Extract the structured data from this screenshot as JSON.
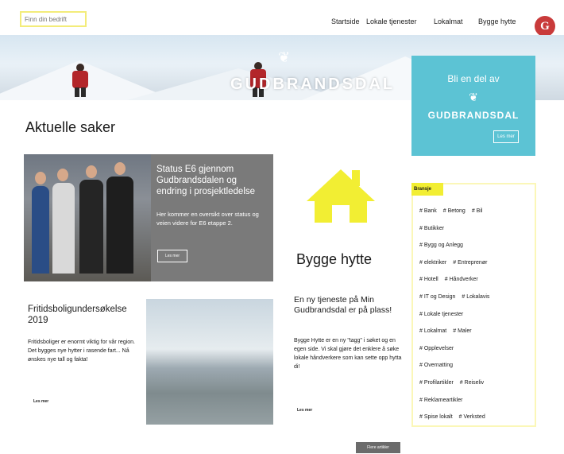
{
  "header": {
    "search_placeholder": "Finn din bedrift",
    "nav": [
      "Startside",
      "Lokale tjenester",
      "Lokalmat",
      "Bygge hytte"
    ],
    "logo_letter": "G"
  },
  "hero": {
    "title": "GUDBRANDSDAL"
  },
  "join_box": {
    "line1": "Bli en del av",
    "line2": "GUDBRANDSDAL",
    "button": "Les mer"
  },
  "section_title": "Aktuelle saker",
  "featured": {
    "title": "Status E6 gjennom Gudbrandsdalen og endring i prosjektledelse",
    "text": "Her kommer en oversikt over status og veien videre for E6 etappe 2.",
    "button": "Les mer"
  },
  "fritidsbolig": {
    "title": "Fritidsboligundersøkelse 2019",
    "text": "Fritidsboliger er enormt viktig for vår region. Det bygges nye hytter i rasende fart... Nå ønskes nye tall og fakta!",
    "more": "Les mer"
  },
  "bygge": {
    "title": "Bygge hytte",
    "article_title": "En ny tjeneste på Min Gudbrandsdal er på plass!",
    "article_text": "Bygge Hytte er en ny \"tagg\" i søket og en egen side. Vi skal gjøre det enklere å søke lokale håndverkere som kan sette opp hytta di!",
    "more": "Les mer"
  },
  "branch": {
    "heading": "Bransje",
    "rows": [
      [
        "# Bank",
        "# Betong",
        "# Bil"
      ],
      [
        "# Butikker"
      ],
      [
        "# Bygg og Anlegg"
      ],
      [
        "# elektriker",
        "# Entreprenør"
      ],
      [
        "# Hotell",
        "# Håndverker"
      ],
      [
        "# IT og Design",
        "# Lokalavis"
      ],
      [
        "# Lokale tjenester"
      ],
      [
        "# Lokalmat",
        "# Maler"
      ],
      [
        "# Opplevelser"
      ],
      [
        "# Overnatting"
      ],
      [
        "# Profilartikler",
        "# Reiseliv"
      ],
      [
        "# Reklameartikler"
      ],
      [
        "# Spise lokalt",
        "# Verksted"
      ]
    ]
  },
  "all_button": "Flere artikler",
  "colors": {
    "accent_yellow": "#f2ee33",
    "join_blue": "#5cc3d4",
    "logo_red": "#c93b3b",
    "dark_gray": "#6b6b6b"
  }
}
